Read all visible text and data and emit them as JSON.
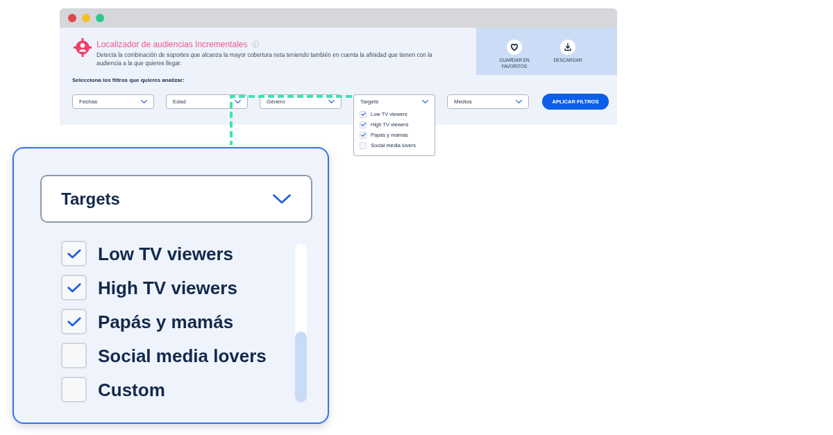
{
  "header": {
    "title": "Localizador de audiencias Incrementales",
    "description": "Detecta la combinación de soportes que alcanza la mayor cobertura neta teniendo también en cuenta la afinidad que tienen con la audiencia a la que quieres llegar."
  },
  "actions": [
    {
      "kind": "favorite",
      "label": "GUARDAR EN FAVORITOS"
    },
    {
      "kind": "download",
      "label": "DESCARGAR"
    }
  ],
  "filters_prompt": "Selecciona los filtros que quieres analizar:",
  "filters": [
    {
      "label": "Fechas",
      "expanded": false
    },
    {
      "label": "Edad",
      "expanded": false
    },
    {
      "label": "Género",
      "expanded": false
    },
    {
      "label": "Targets",
      "expanded": true,
      "options": [
        {
          "label": "Low TV viewers",
          "checked": true
        },
        {
          "label": "High TV viewers",
          "checked": true
        },
        {
          "label": "Papás y mamas",
          "checked": true
        },
        {
          "label": "Social media lovers",
          "checked": false
        }
      ]
    },
    {
      "label": "Medios",
      "expanded": false
    }
  ],
  "apply_button": {
    "label": "APLICAR FILTROS"
  },
  "zoom_panel": {
    "dropdown": {
      "label": "Targets"
    },
    "options": [
      {
        "label": "Low TV viewers",
        "checked": true
      },
      {
        "label": "High TV viewers",
        "checked": true
      },
      {
        "label": "Papás y mamás",
        "checked": true
      },
      {
        "label": "Social media lovers",
        "checked": false
      },
      {
        "label": "Custom",
        "checked": false
      }
    ]
  }
}
